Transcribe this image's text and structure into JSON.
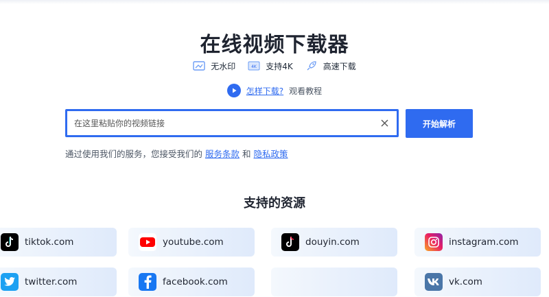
{
  "header": {
    "title": "在线视频下载器",
    "features": [
      {
        "icon": "no-watermark-icon",
        "label": "无水印"
      },
      {
        "icon": "4k-icon",
        "label": "支持4K"
      },
      {
        "icon": "rocket-icon",
        "label": "高速下载"
      }
    ],
    "howto_link": "怎样下载?",
    "howto_text": "观看教程"
  },
  "search": {
    "placeholder": "在这里粘贴你的视频链接",
    "value": "",
    "submit_label": "开始解析"
  },
  "terms": {
    "prefix": "通过使用我们的服务，您接受我们的",
    "service_link": "服务条款",
    "and": "和",
    "privacy_link": "隐私政策"
  },
  "sources": {
    "title": "支持的资源",
    "items": [
      {
        "label": "tiktok.com",
        "icon": "tiktok-icon"
      },
      {
        "label": "youtube.com",
        "icon": "youtube-icon"
      },
      {
        "label": "douyin.com",
        "icon": "douyin-icon"
      },
      {
        "label": "instagram.com",
        "icon": "instagram-icon"
      },
      {
        "label": "twitter.com",
        "icon": "twitter-icon"
      },
      {
        "label": "facebook.com",
        "icon": "facebook-icon"
      },
      {
        "label": "",
        "icon": ""
      },
      {
        "label": "vk.com",
        "icon": "vk-icon"
      }
    ]
  },
  "colors": {
    "accent": "#2f6bf0",
    "card_start": "#f4f8fd",
    "card_end": "#dfeafb"
  }
}
